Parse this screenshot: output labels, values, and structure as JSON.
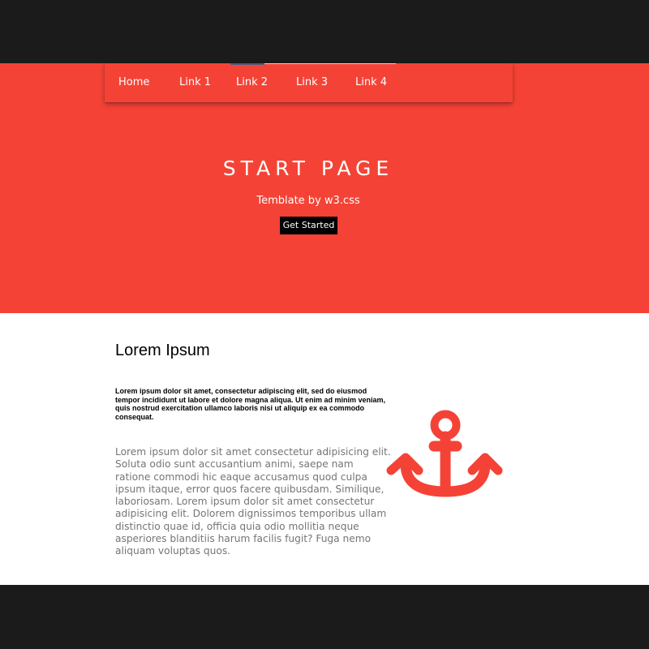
{
  "nav": {
    "items": [
      {
        "label": "Home"
      },
      {
        "label": "Link 1"
      },
      {
        "label": "Link 2"
      },
      {
        "label": "Link 3"
      },
      {
        "label": "Link 4"
      }
    ]
  },
  "hero": {
    "title": "START PAGE",
    "subtitle": "Temblate by w3.css",
    "cta_label": "Get Started"
  },
  "section": {
    "title": "Lorem Ipsum",
    "bold_paragraph": "Lorem ipsum dolor sit amet, consectetur adipiscing elit, sed do eiusmod tempor incididunt ut labore et dolore magna aliqua. Ut enim ad minim veniam, quis nostrud exercitation ullamco laboris nisi ut aliquip ex ea commodo consequat.",
    "body_paragraph": "Lorem ipsum dolor sit amet consectetur adipisicing elit. Soluta odio sunt accusantium animi, saepe nam ratione commodi hic eaque accusamus quod culpa ipsum itaque, error quos facere quibusdam. Similique, laboriosam. Lorem ipsum dolor sit amet consectetur adipisicing elit. Dolorem dignissimos temporibus ullam distinctio quae id, officia quia odio mollitia neque asperiores blanditiis harum facilis fugit? Fuga nemo aliquam voluptas quos.",
    "icon": "anchor-icon"
  },
  "colors": {
    "accent": "#f44336",
    "frame": "#1b1b1b",
    "button": "#000000",
    "muted_text": "#757575"
  }
}
